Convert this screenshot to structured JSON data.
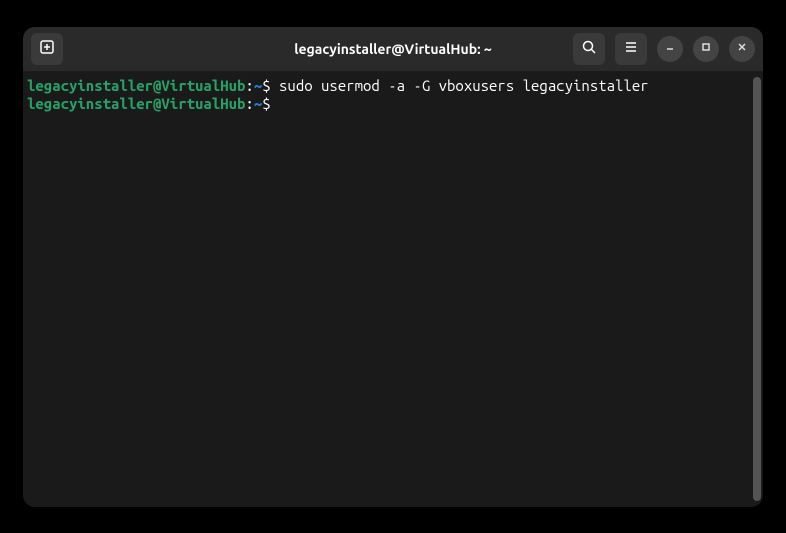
{
  "window": {
    "title": "legacyinstaller@VirtualHub: ~"
  },
  "terminal": {
    "lines": [
      {
        "user_host": "legacyinstaller@VirtualHub",
        "colon": ":",
        "path": "~",
        "prompt": "$",
        "command": " sudo usermod -a -G vboxusers legacyinstaller"
      },
      {
        "user_host": "legacyinstaller@VirtualHub",
        "colon": ":",
        "path": "~",
        "prompt": "$",
        "command": ""
      }
    ]
  },
  "icons": {
    "new_tab": "new-tab-icon",
    "search": "search-icon",
    "menu": "hamburger-icon",
    "minimize": "minimize-icon",
    "maximize": "maximize-icon",
    "close": "close-icon"
  }
}
